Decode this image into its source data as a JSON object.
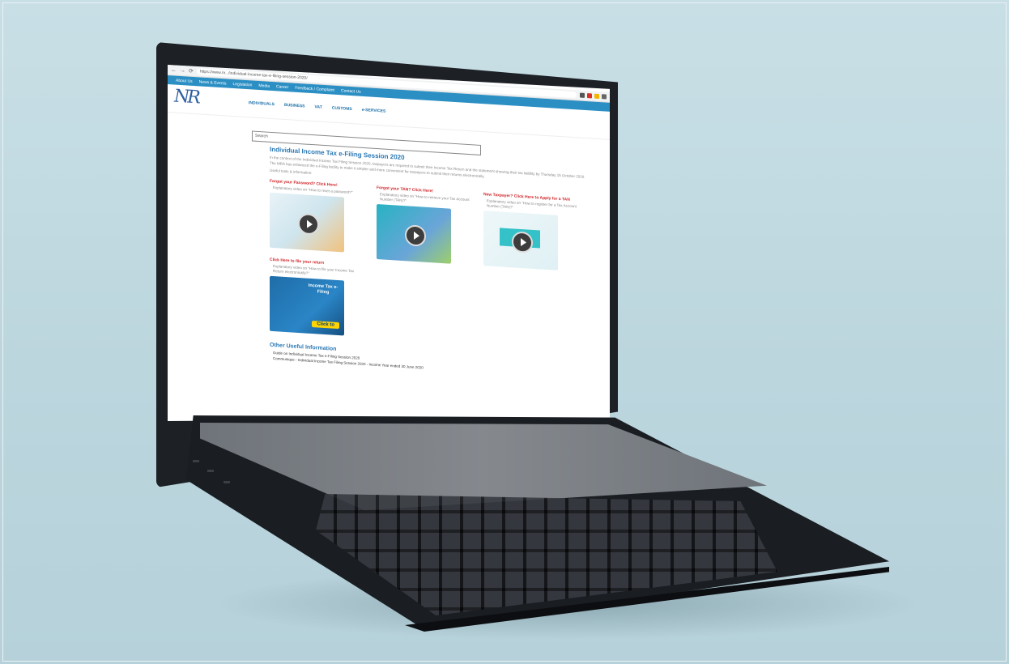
{
  "browser": {
    "url": "https://www.nr.../individual-income-tax-e-filing-session-2020/",
    "nav_glyphs": [
      "←",
      "→",
      "⟳"
    ]
  },
  "topnav": {
    "items": [
      "About Us",
      "News & Events",
      "Legislation",
      "Media",
      "Career",
      "Feedback / Complaint",
      "Contact Us"
    ]
  },
  "header": {
    "logo": "NR",
    "mainnav": [
      "INDIVIDUALS",
      "BUSINESS",
      "VAT",
      "CUSTOMS",
      "e-SERVICES"
    ]
  },
  "search": {
    "placeholder": "Search"
  },
  "page": {
    "title": "Individual Income Tax e-Filing Session 2020",
    "intro": "In the context of the Individual Income Tax Filing Session 2020, taxpayers are required to submit their Income Tax Return and the statement showing their tax liability by Thursday 15 October 2020. The MRA has enhanced the e-Filing facility to make it simpler and more convenient for taxpayers to submit their returns electronically.",
    "intro_tail": "Useful tools & information:",
    "cards": [
      {
        "title": "Forgot your Password? Click Here!",
        "sub": "Explanatory video on \"How to reset a password?\""
      },
      {
        "title": "Forgot your TAN? Click Here!",
        "sub": "Explanatory video on \"How to retrieve your Tax Account Number (TAN)?\""
      },
      {
        "title": "New Taxpayer? Click Here to Apply for a TAN",
        "sub": "Explanatory video on \"How to register for a Tax Account Number (TAN)?\""
      },
      {
        "title": "Click Here to file your return",
        "sub": "Explanatory video on \"How to file your Income Tax Return electronically?\""
      }
    ],
    "promo_text": "Income Tax e-Filing",
    "promo_cta": "Click to",
    "other_heading": "Other Useful Information",
    "other_items": [
      "Guide on Individual Income Tax e-Filing Session 2020",
      "Communique - Individual Income Tax Filing Session 2020 - Income Year ended 30 June 2020"
    ]
  },
  "colors": {
    "topnav": "#2b8fc4",
    "heading": "#2b79b5",
    "link_red": "#d0262b",
    "backdrop": "#bcd6de",
    "laptop": "#1d2126"
  }
}
